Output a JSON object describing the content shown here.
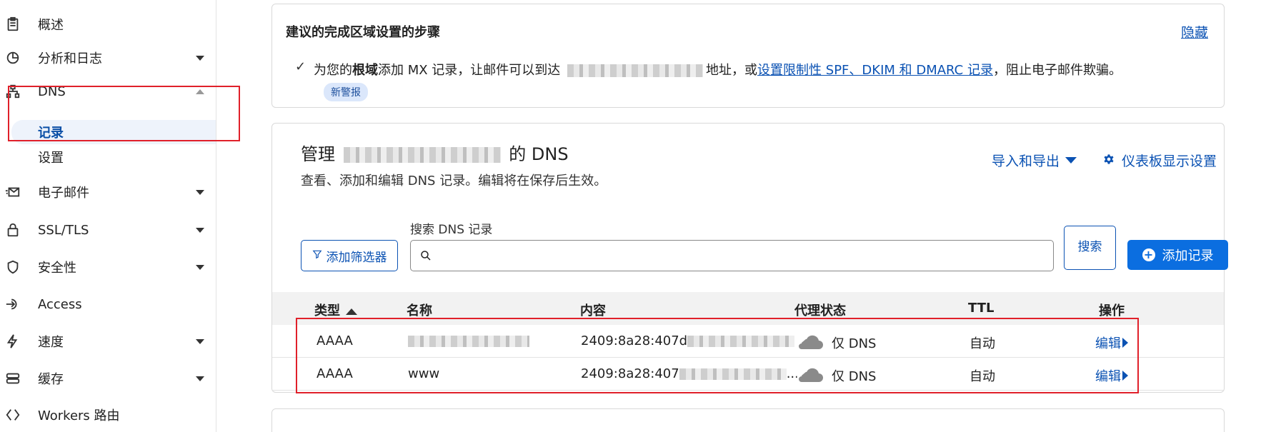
{
  "sidebar": {
    "items": [
      {
        "label": "概述",
        "icon": "clipboard-icon",
        "caret": false
      },
      {
        "label": "分析和日志",
        "icon": "pie-chart-icon",
        "caret": true
      },
      {
        "label": "DNS",
        "icon": "network-icon",
        "caret": true,
        "expanded": true
      },
      {
        "label": "电子邮件",
        "icon": "mail-icon",
        "caret": true
      },
      {
        "label": "SSL/TLS",
        "icon": "lock-icon",
        "caret": true
      },
      {
        "label": "安全性",
        "icon": "shield-icon",
        "caret": true
      },
      {
        "label": "Access",
        "icon": "login-arrow-icon",
        "caret": false
      },
      {
        "label": "速度",
        "icon": "lightning-icon",
        "caret": true
      },
      {
        "label": "缓存",
        "icon": "database-icon",
        "caret": true
      },
      {
        "label": "Workers 路由",
        "icon": "workers-icon",
        "caret": false
      }
    ],
    "dns_sub": [
      {
        "label": "记录",
        "active": true
      },
      {
        "label": "设置",
        "active": false
      }
    ]
  },
  "suggest": {
    "title": "建议的完成区域设置的步骤",
    "hide": "隐藏",
    "check": "✓",
    "text_before": "为您的",
    "text_bold": "根域",
    "text_mid": "添加 MX 记录，让邮件可以到达",
    "text_after": "地址，或",
    "link": "设置限制性 SPF、DKIM 和 DMARC 记录",
    "text_end": "，阻止电子邮件欺骗。",
    "badge": "新警报"
  },
  "dns": {
    "title_prefix": "管理",
    "title_suffix": "的 DNS",
    "description": "查看、添加和编辑 DNS 记录。编辑将在保存后生效。",
    "import_export": "导入和导出",
    "dashboard_settings": "仪表板显示设置",
    "search_label": "搜索 DNS 记录",
    "search_placeholder": "",
    "filter_button": "添加筛选器",
    "search_button": "搜索",
    "add_button": "添加记录",
    "columns": {
      "type": "类型",
      "name": "名称",
      "content": "内容",
      "proxy": "代理状态",
      "ttl": "TTL",
      "actions": "操作"
    },
    "rows": [
      {
        "type": "AAAA",
        "name": "",
        "content": "2409:8a28:407d",
        "proxy": "仅 DNS",
        "ttl": "自动",
        "edit": "编辑"
      },
      {
        "type": "AAAA",
        "name": "www",
        "content": "2409:8a28:407",
        "content_tail": "...",
        "proxy": "仅 DNS",
        "ttl": "自动",
        "edit": "编辑"
      }
    ]
  },
  "colors": {
    "accent": "#0b52b3",
    "primary_button": "#0b6ee0",
    "highlight_box": "#e0202a"
  }
}
